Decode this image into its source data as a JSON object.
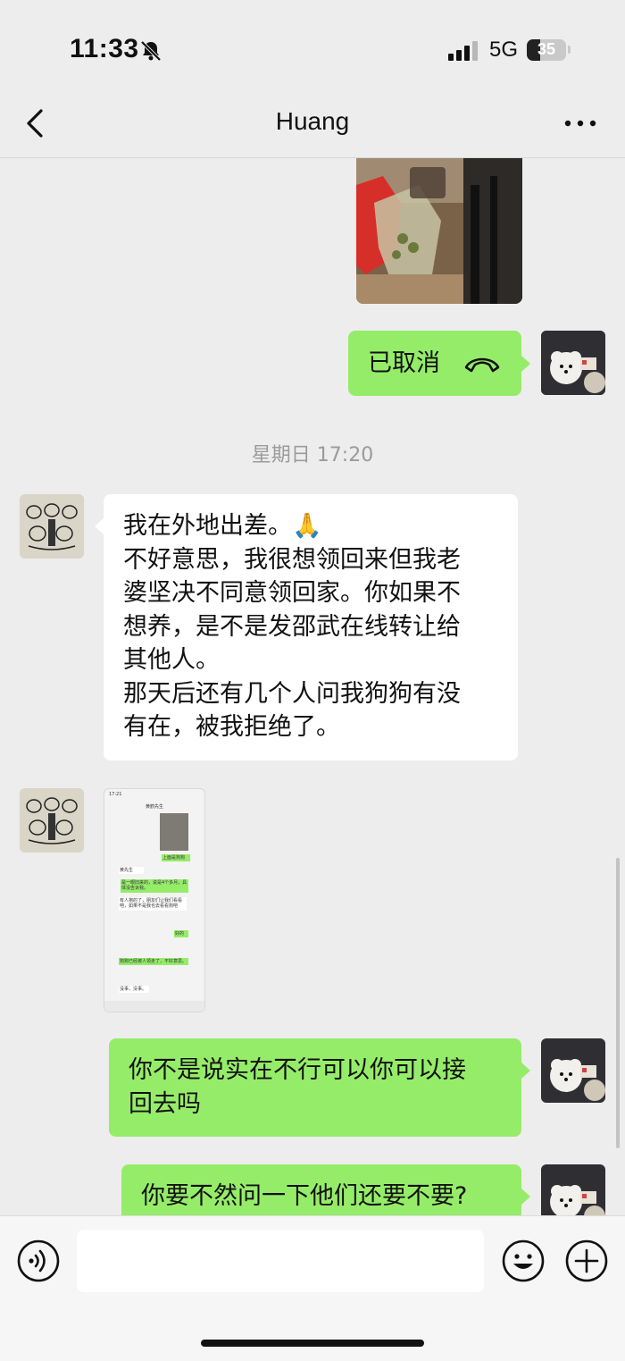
{
  "status_bar": {
    "time": "11:33",
    "network": "5G",
    "battery": "35",
    "battery_level": 0.35
  },
  "nav": {
    "title": "Huang",
    "back_icon": "chevron-left-icon",
    "more_icon": "more-dots-icon"
  },
  "messages": {
    "call": {
      "text": "已取消",
      "icon": "hang-up-phone-icon"
    },
    "timestamp": "星期日 17:20",
    "long_text": {
      "lines": [
        "我在外地出差。🙏",
        "不好意思，我很想领回来但我老",
        "婆坚决不同意领回家。你如果不",
        "想养，是不是发邵武在线转让给",
        "其他人。",
        "那天后还有几个人问我狗狗有没",
        "有在，被我拒绝了。"
      ]
    },
    "screenshot": {
      "time": "17:21",
      "title": "黄鹤先生",
      "msgs": [
        "上面是狗狗",
        "黄先生",
        "是一眼旧来的，说是4个多月，具体没告诉我。",
        "有人抱的了，朋友们让我们看看吧，如果不是我也去看看狗吧",
        "好的",
        "狗狗已经被人领走了，不好意思。",
        "没事，没事。"
      ]
    },
    "reply_1": {
      "lines": [
        "你不是说实在不行可以你可以接",
        "回去吗"
      ]
    },
    "reply_2": {
      "text": "你要不然问一下他们还要不要?"
    }
  },
  "input_bar": {
    "placeholder": "",
    "voice_icon": "voice-icon",
    "emoji_icon": "emoji-icon",
    "plus_icon": "plus-icon"
  },
  "colors": {
    "sent_bubble": "#95ec69",
    "received_bubble": "#ffffff",
    "background": "#ededed"
  }
}
